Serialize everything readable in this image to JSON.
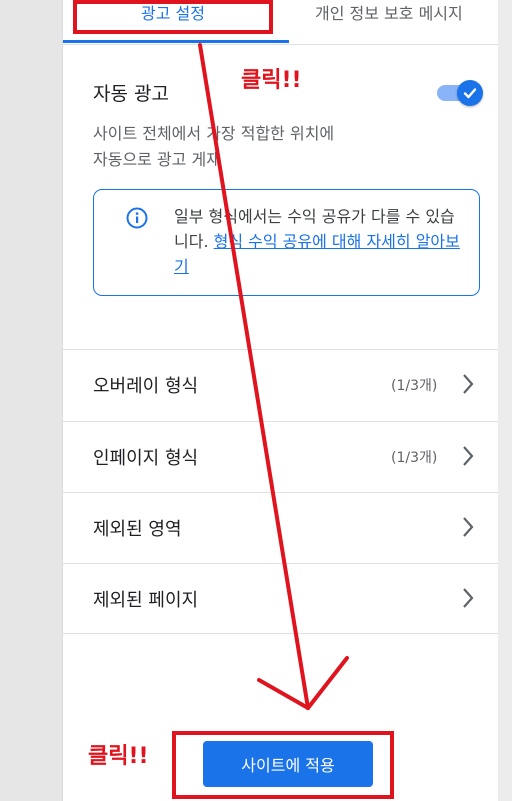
{
  "tabs": [
    {
      "label": "광고 설정",
      "active": true
    },
    {
      "label": "개인 정보 보호 메시지",
      "active": false
    }
  ],
  "auto_ads": {
    "title": "자동 광고",
    "enabled": true,
    "desc_line1": "사이트 전체에서 가장 적합한 위치에",
    "desc_line2": "자동으로 광고 게재"
  },
  "info_box": {
    "icon": "info-icon",
    "text": "일부 형식에서는 수익 공유가 다를 수 있습니다. ",
    "link": "형식 수익 공유에 대해 자세히 알아보기"
  },
  "rows": [
    {
      "label": "오버레이 형식",
      "count": "(1/3개)"
    },
    {
      "label": "인페이지 형식",
      "count": "(1/3개)"
    },
    {
      "label": "제외된 영역",
      "count": ""
    },
    {
      "label": "제외된 페이지",
      "count": ""
    }
  ],
  "apply_button": "사이트에 적용",
  "annotations": {
    "click_top": "클릭!!",
    "click_bottom": "클릭!!",
    "color": "#e0141e"
  },
  "colors": {
    "accent": "#1a73e8",
    "annotation": "#e0141e"
  }
}
